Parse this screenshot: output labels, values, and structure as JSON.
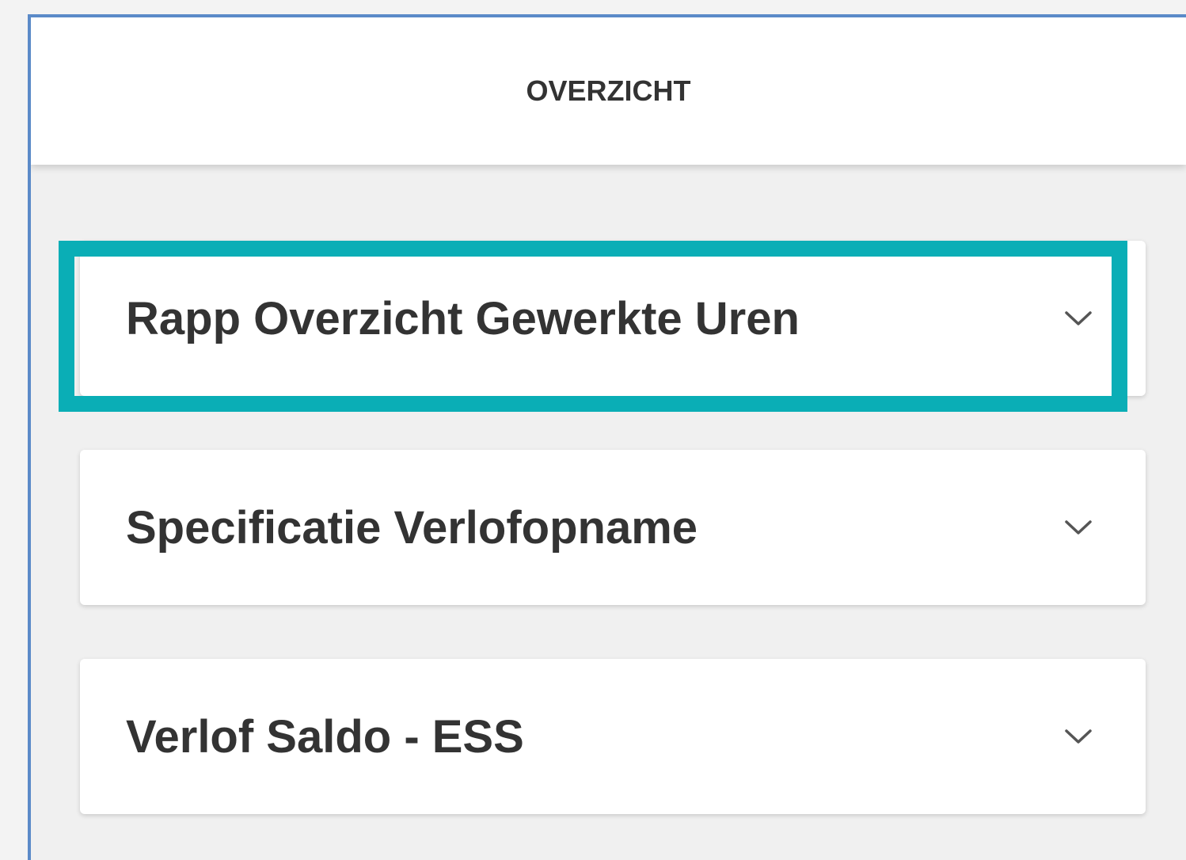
{
  "header": {
    "title": "OVERZICHT"
  },
  "reports": {
    "items": [
      {
        "label": "Rapp Overzicht Gewerkte Uren",
        "icon": "chevron-down-icon"
      },
      {
        "label": "Specificatie Verlofopname",
        "icon": "chevron-down-icon"
      },
      {
        "label": "Verlof Saldo - ESS",
        "icon": "chevron-down-icon"
      }
    ]
  },
  "colors": {
    "highlight": "#0aaeb6",
    "frame_border": "#5b8ac8",
    "text": "#333333"
  }
}
